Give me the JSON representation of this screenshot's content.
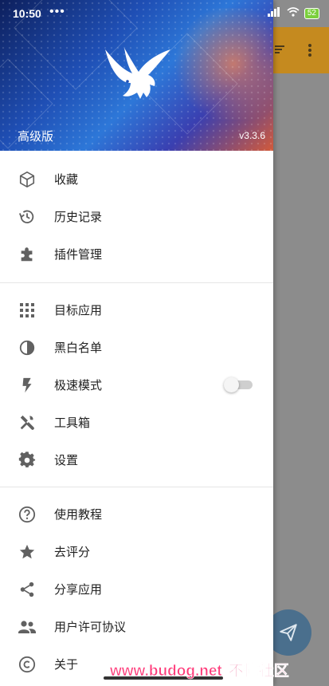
{
  "status_bar": {
    "time": "10:50",
    "dots": "•••",
    "battery": "52"
  },
  "header": {
    "edition": "高级版",
    "version": "v3.3.6"
  },
  "menu": {
    "group1": [
      {
        "label": "收藏",
        "icon": "cube-icon"
      },
      {
        "label": "历史记录",
        "icon": "history-icon"
      },
      {
        "label": "插件管理",
        "icon": "puzzle-icon"
      }
    ],
    "group2": [
      {
        "label": "目标应用",
        "icon": "apps-grid-icon"
      },
      {
        "label": "黑白名单",
        "icon": "contrast-icon"
      },
      {
        "label": "极速模式",
        "icon": "flash-icon",
        "toggle": false
      },
      {
        "label": "工具箱",
        "icon": "tools-icon"
      },
      {
        "label": "设置",
        "icon": "gear-icon"
      }
    ],
    "group3": [
      {
        "label": "使用教程",
        "icon": "help-icon"
      },
      {
        "label": "去评分",
        "icon": "star-icon"
      },
      {
        "label": "分享应用",
        "icon": "share-icon"
      },
      {
        "label": "用户许可协议",
        "icon": "people-icon"
      },
      {
        "label": "关于",
        "icon": "copyright-icon"
      }
    ]
  },
  "watermark": {
    "site": "www.budog.net",
    "name": "不懂社区"
  },
  "colors": {
    "appbar": "#c58a1f",
    "fab": "#4a6f8d",
    "icon": "#616161"
  }
}
